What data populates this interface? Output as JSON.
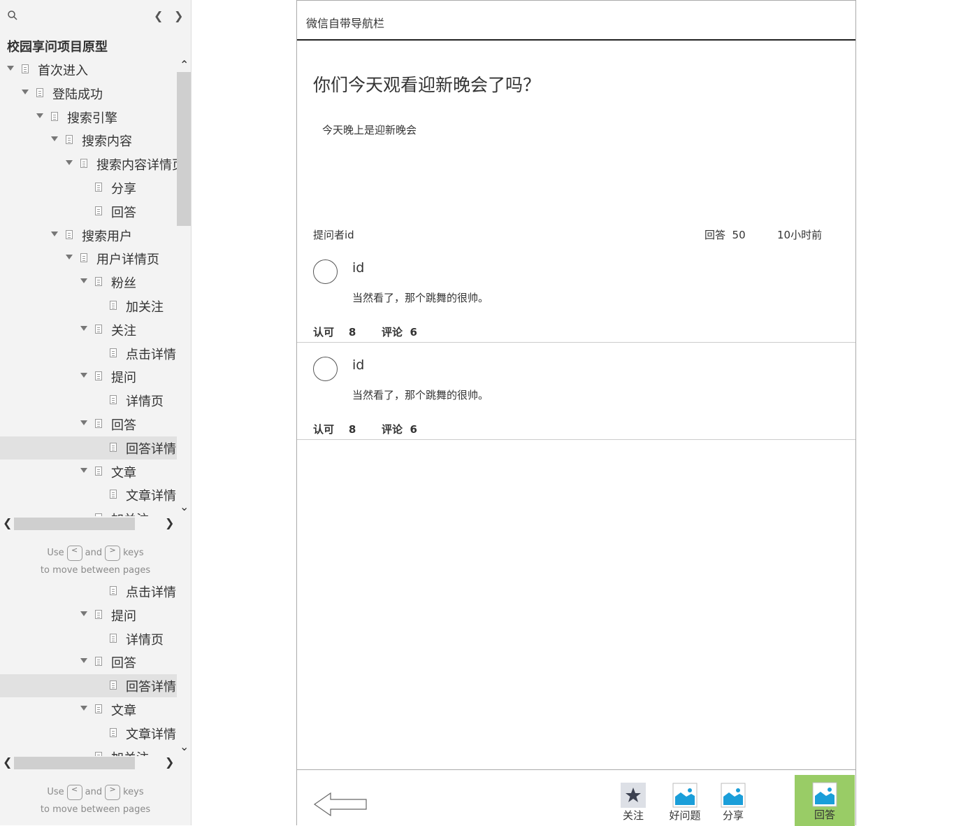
{
  "sidebar": {
    "title": "校园享问项目原型",
    "tree": [
      {
        "label": "首次进入",
        "level": 0,
        "expandable": true,
        "selected": false
      },
      {
        "label": "登陆成功",
        "level": 1,
        "expandable": true,
        "selected": false
      },
      {
        "label": "搜索引擎",
        "level": 2,
        "expandable": true,
        "selected": false
      },
      {
        "label": "搜索内容",
        "level": 3,
        "expandable": true,
        "selected": false
      },
      {
        "label": "搜索内容详情页",
        "level": 4,
        "expandable": true,
        "selected": false
      },
      {
        "label": "分享",
        "level": 5,
        "expandable": false,
        "selected": false
      },
      {
        "label": "回答",
        "level": 5,
        "expandable": false,
        "selected": false
      },
      {
        "label": "搜索用户",
        "level": 3,
        "expandable": true,
        "selected": false
      },
      {
        "label": "用户详情页",
        "level": 4,
        "expandable": true,
        "selected": false
      },
      {
        "label": "粉丝",
        "level": 5,
        "expandable": true,
        "selected": false
      },
      {
        "label": "加关注",
        "level": 6,
        "expandable": false,
        "selected": false
      },
      {
        "label": "关注",
        "level": 5,
        "expandable": true,
        "selected": false
      },
      {
        "label": "点击详情",
        "level": 6,
        "expandable": false,
        "selected": false
      },
      {
        "label": "提问",
        "level": 5,
        "expandable": true,
        "selected": false
      },
      {
        "label": "详情页",
        "level": 6,
        "expandable": false,
        "selected": false
      },
      {
        "label": "回答",
        "level": 5,
        "expandable": true,
        "selected": false
      },
      {
        "label": "回答详情",
        "level": 6,
        "expandable": false,
        "selected": true
      },
      {
        "label": "文章",
        "level": 5,
        "expandable": true,
        "selected": false
      },
      {
        "label": "文章详情",
        "level": 6,
        "expandable": false,
        "selected": false
      },
      {
        "label": "加关注",
        "level": 5,
        "expandable": false,
        "selected": false
      }
    ],
    "tree2": [
      {
        "label": "点击详情",
        "level": 6,
        "expandable": false,
        "selected": false
      },
      {
        "label": "提问",
        "level": 5,
        "expandable": true,
        "selected": false
      },
      {
        "label": "详情页",
        "level": 6,
        "expandable": false,
        "selected": false
      },
      {
        "label": "回答",
        "level": 5,
        "expandable": true,
        "selected": false
      },
      {
        "label": "回答详情",
        "level": 6,
        "expandable": false,
        "selected": true
      },
      {
        "label": "文章",
        "level": 5,
        "expandable": true,
        "selected": false
      },
      {
        "label": "文章详情",
        "level": 6,
        "expandable": false,
        "selected": false
      },
      {
        "label": "加关注",
        "level": 5,
        "expandable": false,
        "selected": false
      }
    ],
    "hint": {
      "use": "Use",
      "and": "and",
      "keys": "keys",
      "line2": "to move between pages",
      "key_prev": "<",
      "key_next": ">"
    }
  },
  "page": {
    "navbar_title": "微信自带导航栏",
    "question_title": "你们今天观看迎新晚会了吗？",
    "question_desc": "今天晚上是迎新晚会",
    "asker": "提问者id",
    "answer_count_label": "回答  50",
    "time": "10小时前",
    "answers": [
      {
        "id": "id",
        "text": "当然看了，那个跳舞的很帅。",
        "approve": "认可    8",
        "comment": "评论  6"
      },
      {
        "id": "id",
        "text": "当然看了，那个跳舞的很帅。",
        "approve": "认可    8",
        "comment": "评论  6"
      }
    ],
    "footer": {
      "follow": "关注",
      "good_question": "好问题",
      "share": "分享",
      "answer": "回答"
    }
  },
  "colors": {
    "answer_button": "#99cc66",
    "image_icon": "#1a9ed9",
    "sidebar_bg": "#f3f3f3"
  }
}
